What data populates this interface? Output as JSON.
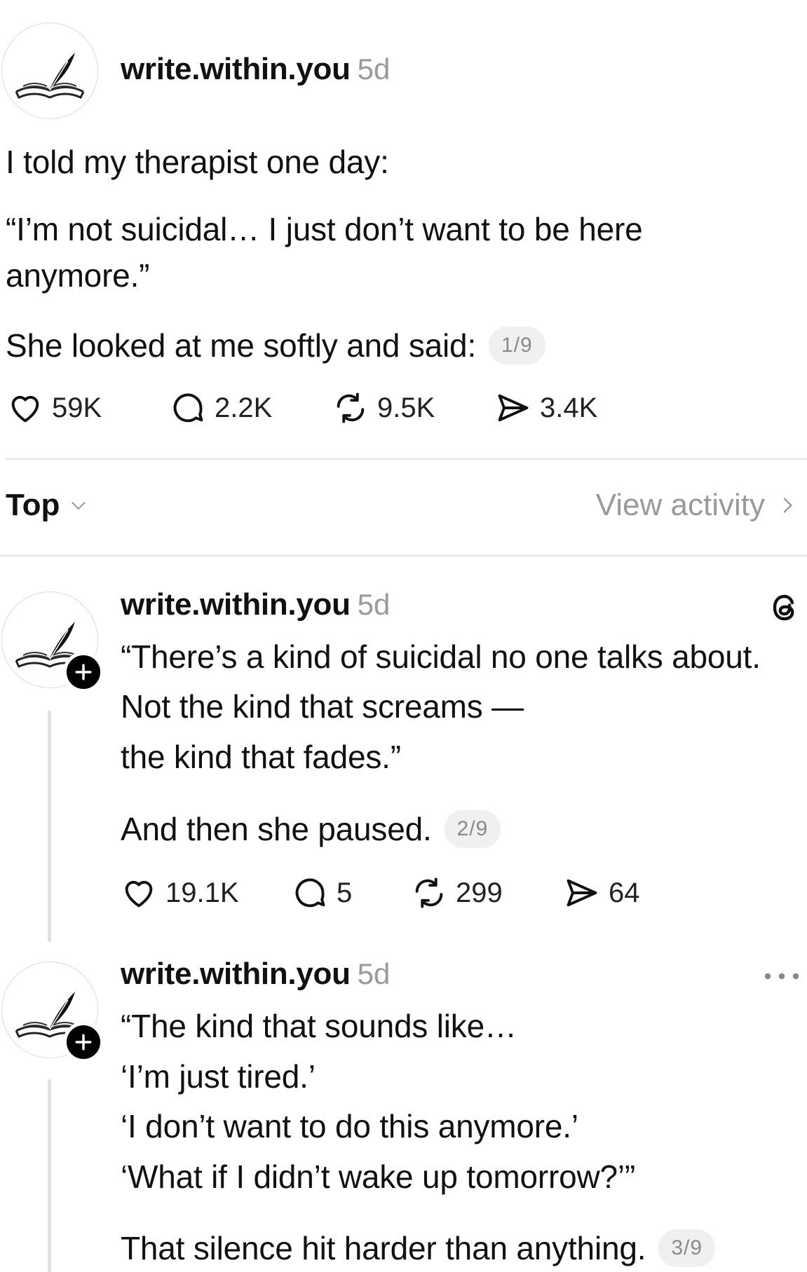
{
  "post1": {
    "username": "write.within.you",
    "time": "5d",
    "lines": [
      "I told my therapist one day:",
      "“I’m not suicidal… I just don’t want to be here",
      "anymore.”",
      "She looked at me softly and said:"
    ],
    "counter": "1/9",
    "likes": "59K",
    "comments": "2.2K",
    "reposts": "9.5K",
    "shares": "3.4K"
  },
  "sort_bar": {
    "sort_label": "Top",
    "view_activity_label": "View activity"
  },
  "reply1": {
    "username": "write.within.you",
    "time": "5d",
    "lines": [
      "“There’s a kind of suicidal no one talks about.",
      "Not the kind that screams —",
      "the kind that fades.”",
      "And then she paused."
    ],
    "counter": "2/9",
    "likes": "19.1K",
    "comments": "5",
    "reposts": "299",
    "shares": "64"
  },
  "reply2": {
    "username": "write.within.you",
    "time": "5d",
    "lines": [
      "“The kind that sounds like…",
      "‘I’m just tired.’",
      "‘I don’t want to do this anymore.’",
      "‘What if I didn’t wake up tomorrow?’”",
      "That silence hit harder than anything."
    ],
    "counter": "3/9"
  },
  "icons": {
    "avatar": "quill-book-icon",
    "like": "heart-icon",
    "comment": "comment-bubble-icon",
    "repost": "repost-icon",
    "share": "send-icon",
    "threads": "threads-logo-icon",
    "more": "more-dots-icon",
    "follow": "plus-icon"
  },
  "colors": {
    "text": "#111111",
    "muted": "#9a9a9a",
    "divider": "#e2e2e2",
    "badge_bg": "#f0f0f0"
  }
}
